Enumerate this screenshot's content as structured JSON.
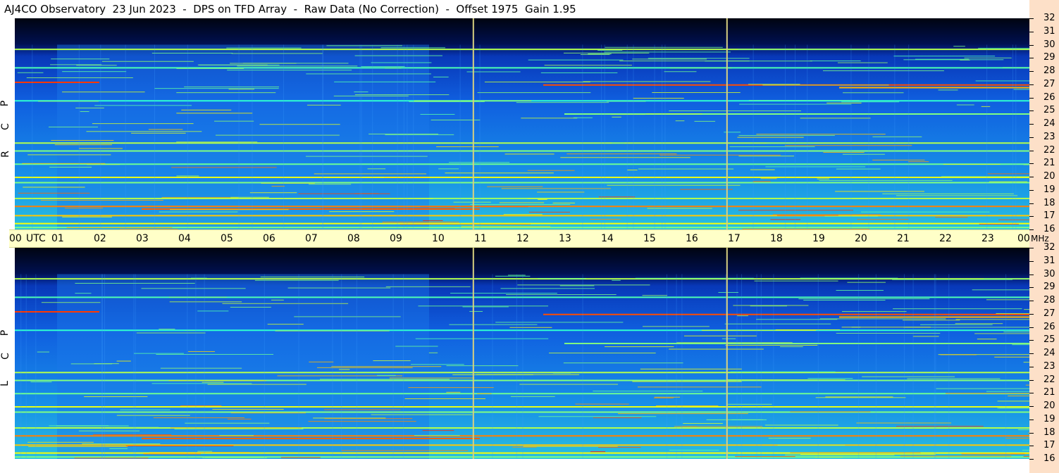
{
  "header": {
    "title": "AJ4CO Observatory  23 Jun 2023  -  DPS on TFD Array  -  Raw Data (No Correction)  -  Offset 1975  Gain 1.95"
  },
  "chart_data": [
    {
      "type": "heatmap",
      "panel": "top",
      "side_label": [
        "R",
        "C",
        "P"
      ],
      "xlabel": "UTC",
      "x_ticks": [
        "00",
        "01",
        "02",
        "03",
        "04",
        "05",
        "06",
        "07",
        "08",
        "09",
        "10",
        "11",
        "12",
        "13",
        "14",
        "15",
        "16",
        "17",
        "18",
        "19",
        "20",
        "21",
        "22",
        "23",
        "00"
      ],
      "x_range_hours": [
        0,
        24
      ],
      "ylabel": "MHz",
      "y_ticks": [
        "16",
        "17",
        "18",
        "19",
        "20",
        "21",
        "22",
        "23",
        "24",
        "25",
        "26",
        "27",
        "28",
        "29",
        "30",
        "31",
        "32"
      ],
      "ylim": [
        16,
        32
      ],
      "colormap": "jet",
      "vertical_markers_hours": [
        10.83,
        16.83
      ]
    },
    {
      "type": "heatmap",
      "panel": "bottom",
      "side_label": [
        "L",
        "C",
        "P"
      ],
      "xlabel": "UTC",
      "x_ticks": [
        "00",
        "01",
        "02",
        "03",
        "04",
        "05",
        "06",
        "07",
        "08",
        "09",
        "10",
        "11",
        "12",
        "13",
        "14",
        "15",
        "16",
        "17",
        "18",
        "19",
        "20",
        "21",
        "22",
        "23",
        "00"
      ],
      "x_range_hours": [
        0,
        24
      ],
      "ylabel": "MHz",
      "y_ticks": [
        "16",
        "17",
        "18",
        "19",
        "20",
        "21",
        "22",
        "23",
        "24",
        "25",
        "26",
        "27",
        "28",
        "29",
        "30",
        "31",
        "32"
      ],
      "ylim": [
        16,
        32
      ],
      "colormap": "jet",
      "vertical_markers_hours": [
        10.83,
        16.83
      ]
    }
  ],
  "colors": {
    "background_low": "#000820",
    "background_mid": "#1060e0",
    "background_high": "#20c0e8",
    "marker_line": "#d8d080",
    "axis_band": "#ffffc8",
    "right_band": "#fde0c8"
  },
  "labels": {
    "utc": "UTC",
    "mhz": "MHz"
  }
}
